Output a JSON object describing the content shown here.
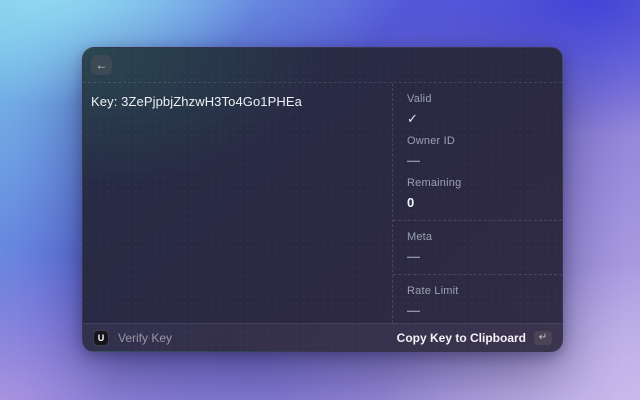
{
  "window": {
    "back_icon": "←"
  },
  "main": {
    "key_text": "Key: 3ZePjpbjZhzwH3To4Go1PHEa"
  },
  "side_panel": {
    "sections": [
      {
        "fields": [
          {
            "label": "Valid",
            "value": "✓"
          },
          {
            "label": "Owner ID",
            "value": "—"
          },
          {
            "label": "Remaining",
            "value": "0"
          }
        ]
      },
      {
        "fields": [
          {
            "label": "Meta",
            "value": "—"
          }
        ]
      },
      {
        "fields": [
          {
            "label": "Rate Limit",
            "value": "—"
          }
        ]
      }
    ]
  },
  "footer": {
    "logo_glyph": "U",
    "app_label": "Verify Key",
    "copy_button_label": "Copy Key to Clipboard",
    "enter_key_icon": "↵"
  },
  "colors": {
    "bg_top_left": "#93dbf3",
    "bg_top_right": "#4245d7",
    "bg_bottom_left": "#a894de",
    "bg_bottom_right": "#c7b9eb",
    "card_top_left": "#26333b",
    "card_top_right": "#252a45",
    "card_bottom": "#322c46",
    "text_primary": "#eef0f3",
    "text_muted": "#9aa2b1"
  }
}
